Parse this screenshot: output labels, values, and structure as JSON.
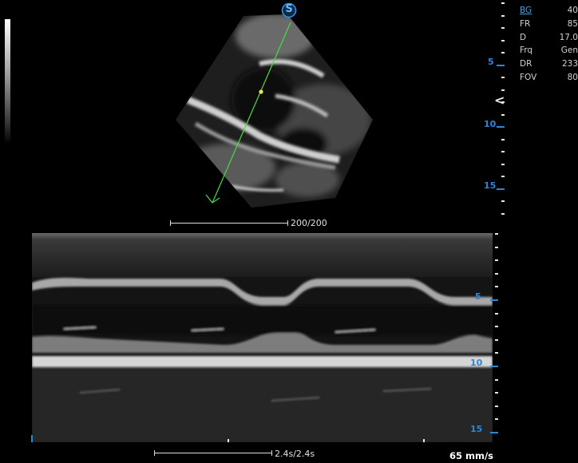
{
  "app": {
    "steer_badge": "S",
    "params": [
      {
        "key": "BG",
        "value": "40"
      },
      {
        "key": "FR",
        "value": "85"
      },
      {
        "key": "D",
        "value": "17.0"
      },
      {
        "key": "Frq",
        "value": "Gen"
      },
      {
        "key": "DR",
        "value": "233"
      },
      {
        "key": "FOV",
        "value": "80"
      }
    ],
    "focus_marker": "<",
    "sector_scale_label": "200/200",
    "time_scale_label": "2.4s/2.4s",
    "sweep_speed": "65 mm/s",
    "upper_ruler": [
      "5",
      "10",
      "15"
    ],
    "lower_ruler": [
      "5",
      "10",
      "15"
    ],
    "colors": {
      "accent": "#2f86d6",
      "mline": "#44dd44",
      "cursor_dot": "#f2e24a"
    }
  }
}
